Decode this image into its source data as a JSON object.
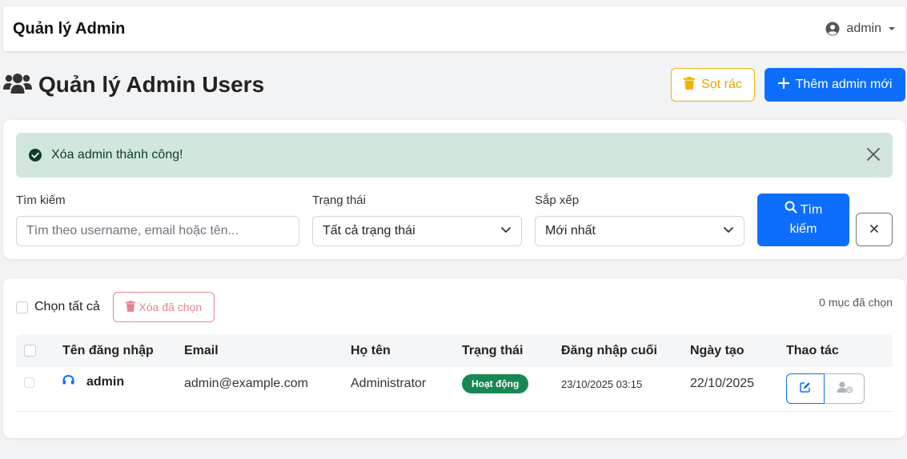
{
  "navbar": {
    "brand": "Quản lý Admin",
    "user": "admin"
  },
  "header": {
    "title": "Quản lý Admin Users",
    "trash_label": "Sọt rác",
    "add_label": "Thêm admin mới"
  },
  "alert": {
    "message": "Xóa admin thành công!"
  },
  "filters": {
    "search_label": "Tìm kiếm",
    "search_placeholder": "Tìm theo username, email hoặc tên...",
    "status_label": "Trạng thái",
    "status_value": "Tất cả trạng thái",
    "sort_label": "Sắp xếp",
    "sort_value": "Mới nhất",
    "search_button_line1": "Tìm",
    "search_button_line2": "kiếm"
  },
  "bulk": {
    "select_all": "Chọn tất cả",
    "delete_selected": "Xóa đã chọn",
    "selected_count": "0 mục đã chọn"
  },
  "table": {
    "columns": [
      "Tên đăng nhập",
      "Email",
      "Họ tên",
      "Trạng thái",
      "Đăng nhập cuối",
      "Ngày tạo",
      "Thao tác"
    ],
    "rows": [
      {
        "username": "admin",
        "email": "admin@example.com",
        "full_name": "Administrator",
        "status": "Hoạt động",
        "last_login": "23/10/2025 03:15",
        "created": "22/10/2025"
      }
    ]
  },
  "colors": {
    "primary": "#0d6efd",
    "warning": "#f0b400",
    "danger_outline": "#e4848e",
    "success": "#198754",
    "alert_bg": "#d1e7dd"
  }
}
